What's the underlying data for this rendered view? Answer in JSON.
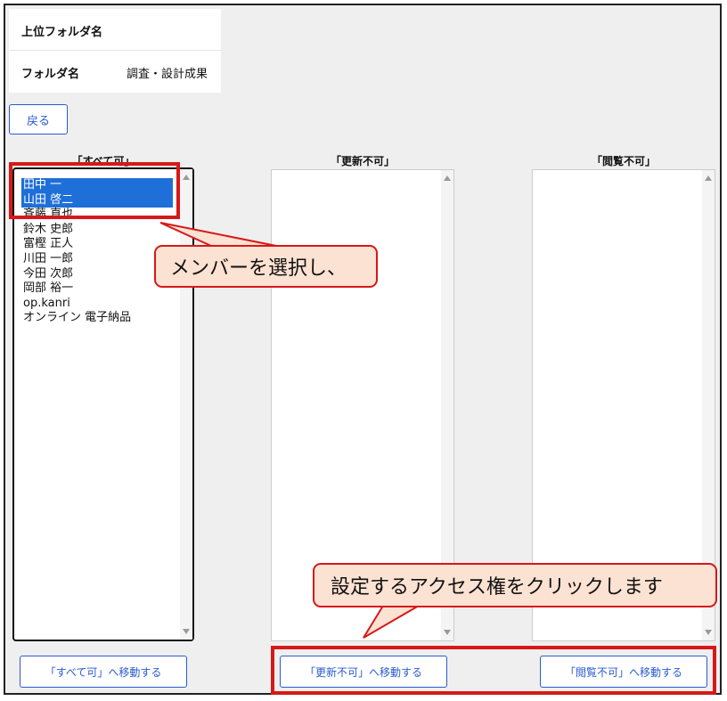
{
  "info": {
    "parent_folder_label": "上位フォルダ名",
    "parent_folder_value": "",
    "folder_label": "フォルダ名",
    "folder_value": "調査・設計成果"
  },
  "back_button": "戻る",
  "columns": {
    "all_allowed": {
      "title": "「すべて可」",
      "items": [
        {
          "name": "田中 一",
          "selected": true
        },
        {
          "name": "山田 啓二",
          "selected": true
        },
        {
          "name": "斉藤 直也",
          "selected": false
        },
        {
          "name": "鈴木 史郎",
          "selected": false
        },
        {
          "name": "富樫 正人",
          "selected": false
        },
        {
          "name": "川田 一郎",
          "selected": false
        },
        {
          "name": "今田 次郎",
          "selected": false
        },
        {
          "name": "岡部 裕一",
          "selected": false
        },
        {
          "name": "op.kanri",
          "selected": false
        },
        {
          "name": "オンライン 電子納品",
          "selected": false
        }
      ],
      "move_button": "「すべて可」へ移動する"
    },
    "no_update": {
      "title": "「更新不可」",
      "items": [],
      "move_button": "「更新不可」へ移動する"
    },
    "no_view": {
      "title": "「閲覧不可」",
      "items": [],
      "move_button": "「閲覧不可」へ移動する"
    }
  },
  "annotations": {
    "callout_select": "メンバーを選択し、",
    "callout_click": "設定するアクセス権をクリックします"
  },
  "colors": {
    "accent": "#2a5ad0",
    "selection": "#1f6fd8",
    "highlight": "#d71818",
    "callout_fill": "#fce2d2"
  }
}
